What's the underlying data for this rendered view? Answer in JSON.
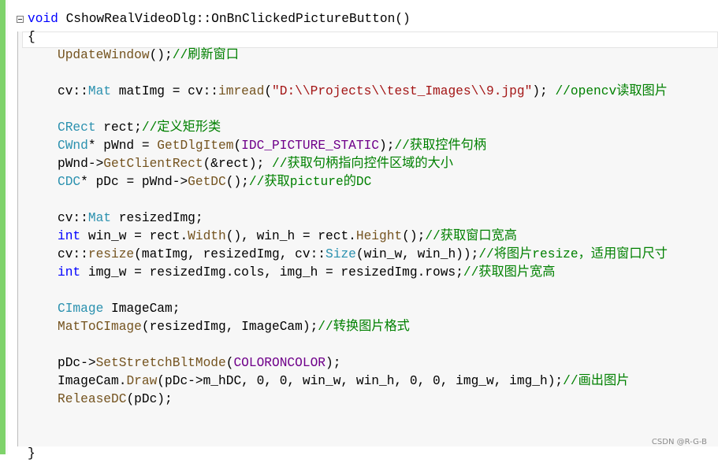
{
  "editor": {
    "colors": {
      "keyword": "#0000ff",
      "type": "#2b91af",
      "function": "#74531f",
      "string": "#a31515",
      "macro": "#6f008a",
      "comment": "#008000",
      "gutter": "#7fd36b"
    },
    "lines": [
      {
        "fn_sig_kw": "void",
        "fn_sig_rest": " CshowRealVideoDlg::OnBnClickedPictureButton()"
      },
      {
        "text": "{"
      },
      {
        "t1": "UpdateWindow",
        "t2": "();",
        "c": "//刷新窗口"
      },
      {},
      {
        "a": "cv::",
        "b": "Mat",
        "c": " matImg = cv::",
        "d": "imread",
        "e": "(",
        "s": "\"D:\\\\Projects\\\\test_Images\\\\9.jpg\"",
        "f": "); ",
        "cm": "//opencv读取图片"
      },
      {},
      {
        "ty": "CRect",
        "rest": " rect;",
        "cm": "//定义矩形类"
      },
      {
        "ty": "CWnd",
        "rest": "* pWnd = ",
        "fn": "GetDlgItem",
        "p1": "(",
        "mac": "IDC_PICTURE_STATIC",
        "p2": ");",
        "cm": "//获取控件句柄"
      },
      {
        "rest": "pWnd->",
        "fn": "GetClientRect",
        "p1": "(&rect); ",
        "cm": "//获取句柄指向控件区域的大小"
      },
      {
        "ty": "CDC",
        "rest": "* pDc = pWnd->",
        "fn": "GetDC",
        "p1": "();",
        "cm": "//获取picture的DC"
      },
      {},
      {
        "a": "cv::",
        "b": "Mat",
        "c": " resizedImg;"
      },
      {
        "kw": "int",
        "r1": " win_w = rect.",
        "f1": "Width",
        "r2": "(), win_h = rect.",
        "f2": "Height",
        "r3": "();",
        "cm": "//获取窗口宽高"
      },
      {
        "a": "cv::",
        "fn": "resize",
        "r1": "(matImg, resizedImg, cv::",
        "ty": "Size",
        "r2": "(win_w, win_h));",
        "cm": "//将图片resize，适用窗口尺寸"
      },
      {
        "kw": "int",
        "r1": " img_w = resizedImg.cols, img_h = resizedImg.rows;",
        "cm": "//获取图片宽高"
      },
      {},
      {
        "ty": "CImage",
        "rest": " ImageCam;"
      },
      {
        "fn": "MatToCImage",
        "rest": "(resizedImg, ImageCam);",
        "cm": "//转换图片格式"
      },
      {},
      {
        "rest": "pDc->",
        "fn": "SetStretchBltMode",
        "p1": "(",
        "mac": "COLORONCOLOR",
        "p2": ");"
      },
      {
        "rest": "ImageCam.",
        "fn": "Draw",
        "p1": "(pDc->m_hDC, 0, 0, win_w, win_h, 0, 0, img_w, img_h);",
        "cm": "//画出图片"
      },
      {
        "fn": "ReleaseDC",
        "p1": "(pDc);"
      },
      {},
      {},
      {
        "text": "}"
      }
    ]
  },
  "watermark": "CSDN @R-G-B"
}
